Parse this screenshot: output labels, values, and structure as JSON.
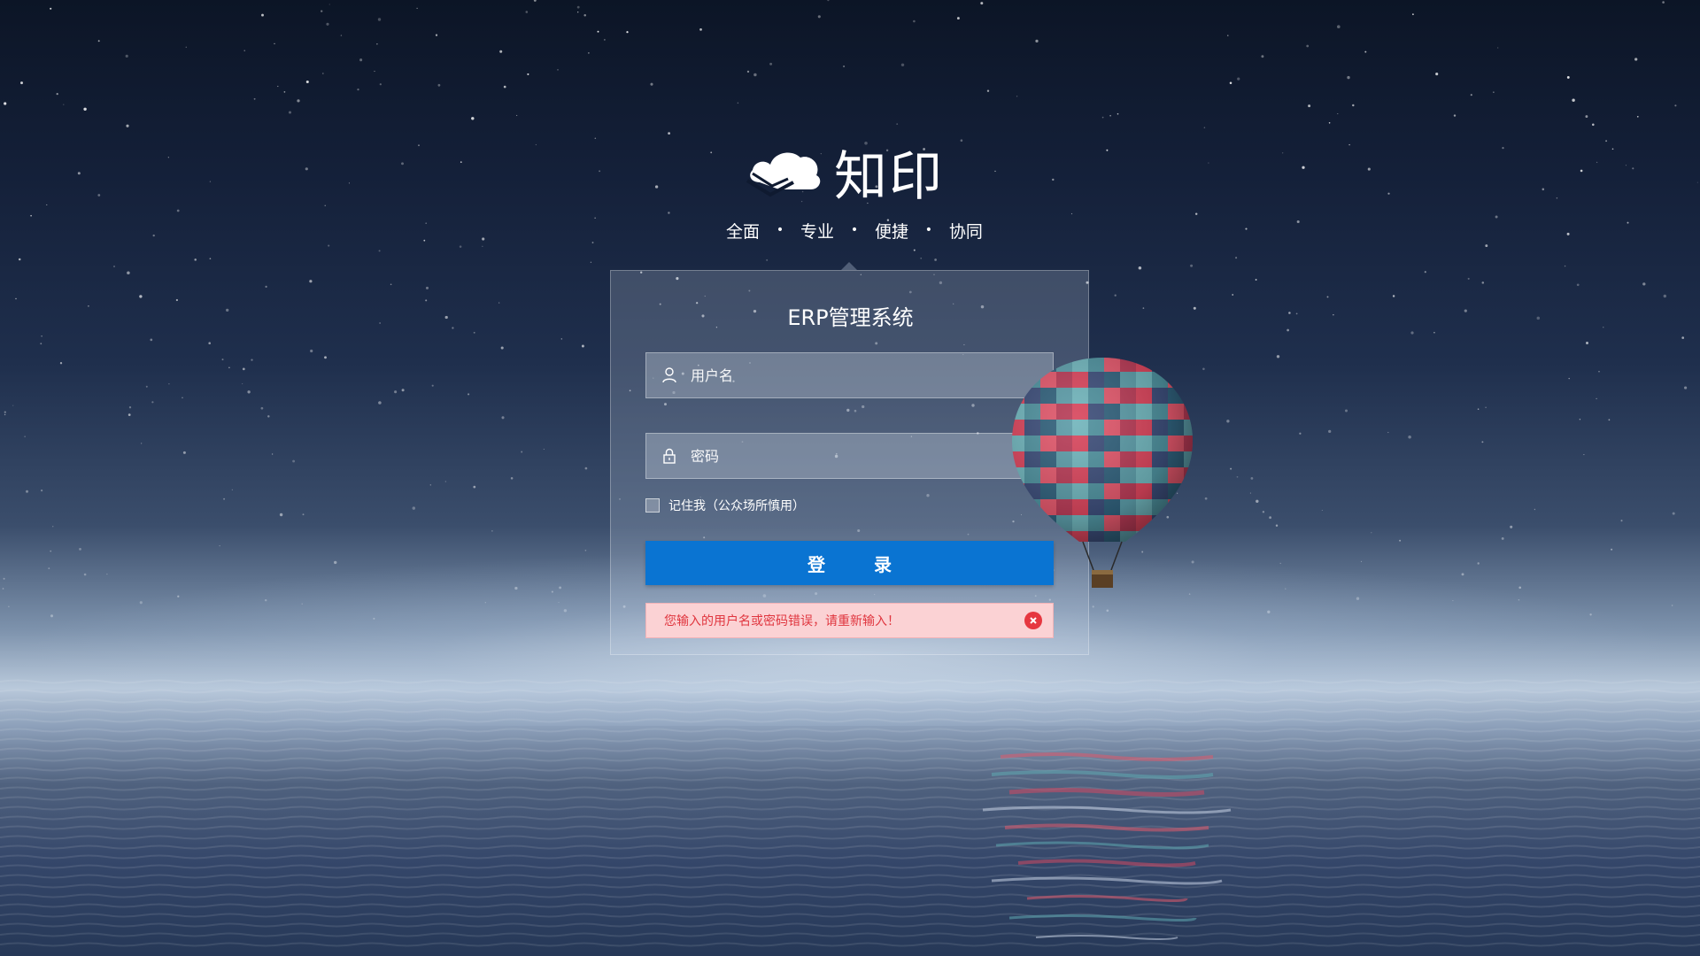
{
  "brand": {
    "name": "知印",
    "logo_icon": "cloud-book-logo"
  },
  "slogan": {
    "items": [
      "全面",
      "专业",
      "便捷",
      "协同"
    ],
    "separator": "•"
  },
  "login_panel": {
    "title": "ERP管理系统",
    "username_placeholder": "用户名",
    "password_placeholder": "密码",
    "remember_label": "记住我（公众场所慎用）",
    "login_button": "登  录",
    "error_message": "您输入的用户名或密码错误，请重新输入！"
  },
  "icons": {
    "username": "user-icon",
    "password": "lock-icon",
    "error_close": "close-icon"
  },
  "colors": {
    "primary_button": "#0a74d2",
    "error_background": "#fbd2d4",
    "error_text": "#e0363f",
    "error_close": "#e63740"
  }
}
